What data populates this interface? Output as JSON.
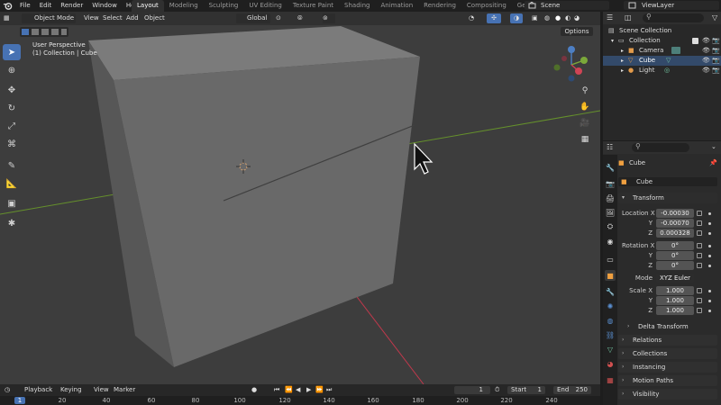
{
  "menu": [
    "File",
    "Edit",
    "Render",
    "Window",
    "Help"
  ],
  "workspaces": [
    "Layout",
    "Modeling",
    "Sculpting",
    "UV Editing",
    "Texture Paint",
    "Shading",
    "Animation",
    "Rendering",
    "Compositing",
    "Geometry Nodes"
  ],
  "active_workspace": "Layout",
  "scene": "Scene",
  "view_layer": "ViewLayer",
  "viewport": {
    "mode": "Object Mode",
    "menus": [
      "View",
      "Select",
      "Add",
      "Object"
    ],
    "transform_orientation": "Global",
    "options": "Options",
    "perspective": "User Perspective",
    "context": "(1) Collection | Cube"
  },
  "outliner": {
    "root": "Scene Collection",
    "collection": "Collection",
    "items": [
      "Camera",
      "Cube",
      "Light"
    ]
  },
  "properties": {
    "object_name": "Cube",
    "datablock": "Cube",
    "transform_header": "Transform",
    "location_label": "Location X",
    "location": {
      "x": "-0.00030",
      "y": "-0.00070",
      "z": "0.000328"
    },
    "rotation_label": "Rotation X",
    "rotation": {
      "x": "0°",
      "y": "0°",
      "z": "0°"
    },
    "mode_label": "Mode",
    "mode_value": "XYZ Euler",
    "scale_label": "Scale X",
    "scale": {
      "x": "1.000",
      "y": "1.000",
      "z": "1.000"
    },
    "axis": {
      "y": "Y",
      "z": "Z"
    },
    "subpanels": [
      "Delta Transform"
    ],
    "panels": [
      "Relations",
      "Collections",
      "Instancing",
      "Motion Paths",
      "Visibility"
    ]
  },
  "timeline": {
    "menus": [
      "Playback",
      "Keying",
      "View",
      "Marker"
    ],
    "current_frame": "1",
    "start_label": "Start",
    "start": "1",
    "end_label": "End",
    "end": "250",
    "ruler": [
      "20",
      "40",
      "60",
      "80",
      "100",
      "120",
      "140",
      "160",
      "180",
      "200",
      "220",
      "240"
    ],
    "cursor": "1"
  },
  "colors": {
    "accent": "#4772b3",
    "viewport_bg": "#3d3d3d",
    "x_axis": "#c0394c",
    "y_axis": "#6a9a2a"
  }
}
